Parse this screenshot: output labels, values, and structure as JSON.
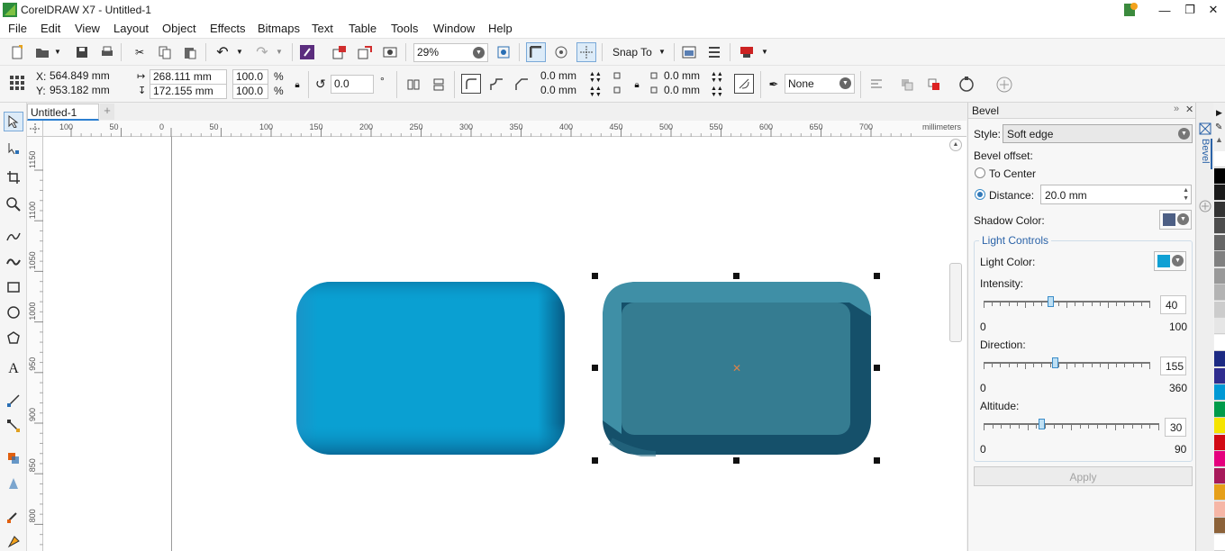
{
  "window": {
    "title": "CorelDRAW X7 - Untitled-1"
  },
  "menu": [
    "File",
    "Edit",
    "View",
    "Layout",
    "Object",
    "Effects",
    "Bitmaps",
    "Text",
    "Table",
    "Tools",
    "Window",
    "Help"
  ],
  "toolbar1": {
    "zoom": "29%",
    "snap_to": "Snap To"
  },
  "property_bar": {
    "x": "564.849 mm",
    "y": "953.182 mm",
    "width": "268.111 mm",
    "height": "172.155 mm",
    "scale_w": "100.0",
    "scale_h": "100.0",
    "pct": "%",
    "angle": "0.0",
    "degree": "°",
    "corner_a1": "0.0 mm",
    "corner_a2": "0.0 mm",
    "corner_b1": "0.0 mm",
    "corner_b2": "0.0 mm",
    "outline": "None",
    "x_label": "X:",
    "y_label": "Y:"
  },
  "document": {
    "tab": "Untitled-1"
  },
  "ruler": {
    "units": "millimeters",
    "h_labels": [
      "100",
      "50",
      "0",
      "50",
      "100",
      "150",
      "200",
      "250",
      "300",
      "350",
      "400",
      "450",
      "500",
      "550",
      "600",
      "650",
      "700"
    ],
    "v_labels": [
      "1150",
      "1100",
      "1050",
      "1000",
      "950",
      "900",
      "850",
      "800"
    ]
  },
  "colors": {
    "object1": "#0aa0d2",
    "object2_face": "#357c91",
    "object2_edge": "#15506a",
    "light": "#0fa0d4",
    "shadow": "#4d5f85"
  },
  "bevel": {
    "title": "Bevel",
    "style_label": "Style:",
    "style_value": "Soft edge",
    "offset_label": "Bevel offset:",
    "to_center": "To Center",
    "distance_label": "Distance:",
    "distance_value": "20.0 mm",
    "shadow_color_label": "Shadow Color:",
    "light_controls_label": "Light Controls",
    "light_color_label": "Light Color:",
    "intensity": {
      "label": "Intensity:",
      "value": "40",
      "min": "0",
      "max": "100",
      "fraction": 0.4
    },
    "direction": {
      "label": "Direction:",
      "value": "155",
      "min": "0",
      "max": "360",
      "fraction": 0.43
    },
    "altitude": {
      "label": "Altitude:",
      "value": "30",
      "min": "0",
      "max": "90",
      "fraction": 0.33
    },
    "apply": "Apply",
    "side_tab": "Bevel"
  },
  "palette": [
    "#ffffff",
    "#000000",
    "#1a1a1a",
    "#333333",
    "#4d4d4d",
    "#666666",
    "#808080",
    "#999999",
    "#b3b3b3",
    "#cccccc",
    "#e6e6e6",
    "#ffffff",
    "#1c2a83",
    "#2f2d8f",
    "#0099d5",
    "#009b4a",
    "#f5e400",
    "#d20a14",
    "#e5007e",
    "#a7195a",
    "#e69f19",
    "#f6b6a6",
    "#8c6239",
    "#ffffff"
  ]
}
